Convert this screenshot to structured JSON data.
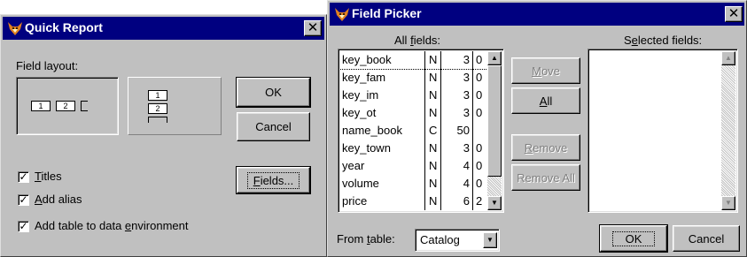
{
  "quick_report": {
    "title": "Quick Report",
    "field_layout_label": "Field layout:",
    "layout_columns_boxes": [
      "1",
      "2"
    ],
    "layout_rows_boxes": [
      "1",
      "2"
    ],
    "ok_label": "OK",
    "cancel_label": "Cancel",
    "fields_label": "Fields...",
    "checkboxes": [
      {
        "label": "Titles",
        "checked": true
      },
      {
        "label": "Add alias",
        "checked": true
      },
      {
        "label": "Add table to data environment",
        "checked": true
      }
    ]
  },
  "field_picker": {
    "title": "Field Picker",
    "all_fields_label": "All fields:",
    "selected_fields_label": "Selected fields:",
    "fields": [
      {
        "name": "key_book",
        "type": "N",
        "width": "3",
        "dec": "0"
      },
      {
        "name": "key_fam",
        "type": "N",
        "width": "3",
        "dec": "0"
      },
      {
        "name": "key_im",
        "type": "N",
        "width": "3",
        "dec": "0"
      },
      {
        "name": "key_ot",
        "type": "N",
        "width": "3",
        "dec": "0"
      },
      {
        "name": "name_book",
        "type": "C",
        "width": "50",
        "dec": ""
      },
      {
        "name": "key_town",
        "type": "N",
        "width": "3",
        "dec": "0"
      },
      {
        "name": "year",
        "type": "N",
        "width": "4",
        "dec": "0"
      },
      {
        "name": "volume",
        "type": "N",
        "width": "4",
        "dec": "0"
      },
      {
        "name": "price",
        "type": "N",
        "width": "6",
        "dec": "2"
      }
    ],
    "move_label": "Move",
    "all_label": "All",
    "remove_label": "Remove",
    "remove_all_label": "Remove All",
    "from_table_label": "From table:",
    "from_table_value": "Catalog",
    "ok_label": "OK",
    "cancel_label": "Cancel"
  },
  "colors": {
    "titlebar": "#000080",
    "dialog_face": "#c0c0c0",
    "disabled_text": "#808080"
  },
  "icons": {
    "app_icon": "fox-icon",
    "close": "close-icon"
  }
}
